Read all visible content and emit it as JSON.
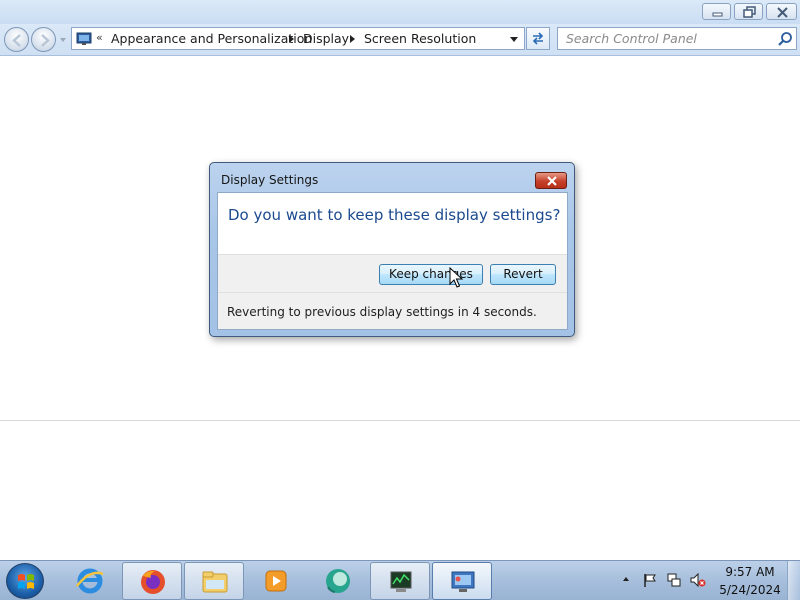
{
  "window": {
    "buttons": [
      "minimize-icon",
      "restore-icon",
      "close-icon"
    ]
  },
  "navigation": {
    "back_icon": "back-arrow-icon",
    "forward_icon": "forward-arrow-icon",
    "address_icon": "control-panel-icon",
    "overflow_chevron": "«",
    "breadcrumbs": [
      "Appearance and Personalization",
      "Display",
      "Screen Resolution"
    ],
    "search": {
      "placeholder": "Search Control Panel",
      "value": ""
    }
  },
  "dialog": {
    "title": "Display Settings",
    "question": "Do you want to keep these display settings?",
    "buttons": {
      "keep_label": "Keep changes",
      "revert_label": "Revert"
    },
    "countdown_text": "Reverting to previous display settings in 4 seconds."
  },
  "taskbar": {
    "start_icon": "windows-start-icon",
    "items": [
      {
        "icon": "internet-explorer-icon",
        "state": "pinned"
      },
      {
        "icon": "firefox-icon",
        "state": "running"
      },
      {
        "icon": "file-explorer-icon",
        "state": "running"
      },
      {
        "icon": "media-player-icon",
        "state": "pinned"
      },
      {
        "icon": "chat-app-icon",
        "state": "pinned"
      },
      {
        "icon": "task-manager-icon",
        "state": "running"
      },
      {
        "icon": "control-panel-icon",
        "state": "active"
      }
    ],
    "tray_icons": [
      "show-hidden-icons-icon",
      "action-center-flag-icon",
      "network-icon",
      "volume-muted-icon"
    ],
    "clock": {
      "time": "9:57 AM",
      "date": "5/24/2024"
    }
  },
  "colors": {
    "dialog_question": "#1b4a8f",
    "chrome_blue": "#cfe0f4",
    "close_red": "#c6402a",
    "button_border": "#3c7fb1"
  }
}
